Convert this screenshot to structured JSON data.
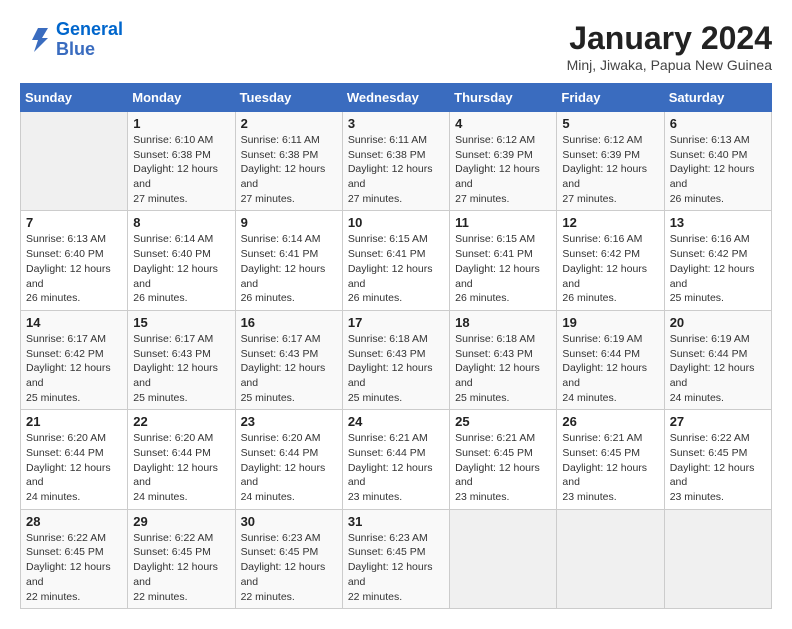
{
  "header": {
    "logo_line1": "General",
    "logo_line2": "Blue",
    "month_title": "January 2024",
    "location": "Minj, Jiwaka, Papua New Guinea"
  },
  "days_of_week": [
    "Sunday",
    "Monday",
    "Tuesday",
    "Wednesday",
    "Thursday",
    "Friday",
    "Saturday"
  ],
  "weeks": [
    [
      {
        "day": "",
        "sunrise": "",
        "sunset": "",
        "daylight": ""
      },
      {
        "day": "1",
        "sunrise": "6:10 AM",
        "sunset": "6:38 PM",
        "daylight": "12 hours and 27 minutes."
      },
      {
        "day": "2",
        "sunrise": "6:11 AM",
        "sunset": "6:38 PM",
        "daylight": "12 hours and 27 minutes."
      },
      {
        "day": "3",
        "sunrise": "6:11 AM",
        "sunset": "6:38 PM",
        "daylight": "12 hours and 27 minutes."
      },
      {
        "day": "4",
        "sunrise": "6:12 AM",
        "sunset": "6:39 PM",
        "daylight": "12 hours and 27 minutes."
      },
      {
        "day": "5",
        "sunrise": "6:12 AM",
        "sunset": "6:39 PM",
        "daylight": "12 hours and 27 minutes."
      },
      {
        "day": "6",
        "sunrise": "6:13 AM",
        "sunset": "6:40 PM",
        "daylight": "12 hours and 26 minutes."
      }
    ],
    [
      {
        "day": "7",
        "sunrise": "6:13 AM",
        "sunset": "6:40 PM",
        "daylight": "12 hours and 26 minutes."
      },
      {
        "day": "8",
        "sunrise": "6:14 AM",
        "sunset": "6:40 PM",
        "daylight": "12 hours and 26 minutes."
      },
      {
        "day": "9",
        "sunrise": "6:14 AM",
        "sunset": "6:41 PM",
        "daylight": "12 hours and 26 minutes."
      },
      {
        "day": "10",
        "sunrise": "6:15 AM",
        "sunset": "6:41 PM",
        "daylight": "12 hours and 26 minutes."
      },
      {
        "day": "11",
        "sunrise": "6:15 AM",
        "sunset": "6:41 PM",
        "daylight": "12 hours and 26 minutes."
      },
      {
        "day": "12",
        "sunrise": "6:16 AM",
        "sunset": "6:42 PM",
        "daylight": "12 hours and 26 minutes."
      },
      {
        "day": "13",
        "sunrise": "6:16 AM",
        "sunset": "6:42 PM",
        "daylight": "12 hours and 25 minutes."
      }
    ],
    [
      {
        "day": "14",
        "sunrise": "6:17 AM",
        "sunset": "6:42 PM",
        "daylight": "12 hours and 25 minutes."
      },
      {
        "day": "15",
        "sunrise": "6:17 AM",
        "sunset": "6:43 PM",
        "daylight": "12 hours and 25 minutes."
      },
      {
        "day": "16",
        "sunrise": "6:17 AM",
        "sunset": "6:43 PM",
        "daylight": "12 hours and 25 minutes."
      },
      {
        "day": "17",
        "sunrise": "6:18 AM",
        "sunset": "6:43 PM",
        "daylight": "12 hours and 25 minutes."
      },
      {
        "day": "18",
        "sunrise": "6:18 AM",
        "sunset": "6:43 PM",
        "daylight": "12 hours and 25 minutes."
      },
      {
        "day": "19",
        "sunrise": "6:19 AM",
        "sunset": "6:44 PM",
        "daylight": "12 hours and 24 minutes."
      },
      {
        "day": "20",
        "sunrise": "6:19 AM",
        "sunset": "6:44 PM",
        "daylight": "12 hours and 24 minutes."
      }
    ],
    [
      {
        "day": "21",
        "sunrise": "6:20 AM",
        "sunset": "6:44 PM",
        "daylight": "12 hours and 24 minutes."
      },
      {
        "day": "22",
        "sunrise": "6:20 AM",
        "sunset": "6:44 PM",
        "daylight": "12 hours and 24 minutes."
      },
      {
        "day": "23",
        "sunrise": "6:20 AM",
        "sunset": "6:44 PM",
        "daylight": "12 hours and 24 minutes."
      },
      {
        "day": "24",
        "sunrise": "6:21 AM",
        "sunset": "6:44 PM",
        "daylight": "12 hours and 23 minutes."
      },
      {
        "day": "25",
        "sunrise": "6:21 AM",
        "sunset": "6:45 PM",
        "daylight": "12 hours and 23 minutes."
      },
      {
        "day": "26",
        "sunrise": "6:21 AM",
        "sunset": "6:45 PM",
        "daylight": "12 hours and 23 minutes."
      },
      {
        "day": "27",
        "sunrise": "6:22 AM",
        "sunset": "6:45 PM",
        "daylight": "12 hours and 23 minutes."
      }
    ],
    [
      {
        "day": "28",
        "sunrise": "6:22 AM",
        "sunset": "6:45 PM",
        "daylight": "12 hours and 22 minutes."
      },
      {
        "day": "29",
        "sunrise": "6:22 AM",
        "sunset": "6:45 PM",
        "daylight": "12 hours and 22 minutes."
      },
      {
        "day": "30",
        "sunrise": "6:23 AM",
        "sunset": "6:45 PM",
        "daylight": "12 hours and 22 minutes."
      },
      {
        "day": "31",
        "sunrise": "6:23 AM",
        "sunset": "6:45 PM",
        "daylight": "12 hours and 22 minutes."
      },
      {
        "day": "",
        "sunrise": "",
        "sunset": "",
        "daylight": ""
      },
      {
        "day": "",
        "sunrise": "",
        "sunset": "",
        "daylight": ""
      },
      {
        "day": "",
        "sunrise": "",
        "sunset": "",
        "daylight": ""
      }
    ]
  ]
}
